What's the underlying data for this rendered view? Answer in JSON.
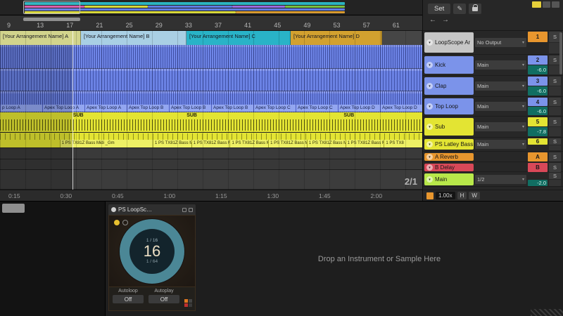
{
  "controls": {
    "set_label": "Set"
  },
  "icons": {
    "pencil": "✎",
    "arrow_left": "←",
    "arrow_right": "→",
    "chevron_down": "▾",
    "fold": "▾"
  },
  "transport": {
    "position": "2/1",
    "zoom": "1.00x",
    "h": "H",
    "w": "W"
  },
  "ruler": {
    "bars": [
      "9",
      "13",
      "17",
      "21",
      "25",
      "29",
      "33",
      "37",
      "41",
      "45",
      "49",
      "53",
      "57",
      "61"
    ],
    "times": [
      "0:15",
      "0:30",
      "0:45",
      "1:00",
      "1:15",
      "1:30",
      "1:45",
      "2:00"
    ]
  },
  "sections": [
    {
      "label": "[Your Arrangement Name] A",
      "color": "#d2d48c"
    },
    {
      "label": "[Your Arrangement Name] B",
      "color": "#a9cfe4"
    },
    {
      "label": "[Your Arrangement Name] C",
      "color": "#29b3c7"
    },
    {
      "label": "[Your Arrangement Name] D",
      "color": "#d2a12f"
    }
  ],
  "clips": {
    "top_loop": [
      "p Loop A",
      "Apex Top Loop A",
      "Apex Top Loop A",
      "Apex Top Loop B",
      "Apex Top Loop B",
      "Apex Top Loop B",
      "Apex Top Loop C",
      "Apex Top Loop C",
      "Apex Top Loop D",
      "Apex Top Loop D"
    ],
    "sub": [
      "SUB",
      "SUB",
      "SUB"
    ],
    "bass": [
      "1 PS TX81Z Bass Midi _Gm",
      "1 PS TX81Z Bass M",
      "1 PS TX81Z Bass M",
      "1 PS TX81Z Bass M",
      "1 PS TX81Z Bass M",
      "1 PS TX81Z Bass M",
      "1 PS TX81Z Bass M",
      "1 PS TX8"
    ]
  },
  "tracks": [
    {
      "name": "LoopScope Ar",
      "routing": "No Output",
      "num": "1",
      "num_color": "#e8962e",
      "name_bg": "#c6c6c6",
      "vol": "",
      "solo": "S"
    },
    {
      "name": "Kick",
      "routing": "Main",
      "num": "2",
      "num_color": "#7b93ea",
      "name_bg": "#7b93ea",
      "vol": "-6.0",
      "solo": "S"
    },
    {
      "name": "Clap",
      "routing": "Main",
      "num": "3",
      "num_color": "#7b93ea",
      "name_bg": "#7b93ea",
      "vol": "-6.0",
      "solo": "S"
    },
    {
      "name": "Top Loop",
      "routing": "Main",
      "num": "4",
      "num_color": "#7b93ea",
      "name_bg": "#7b93ea",
      "vol": "-6.0",
      "solo": "S"
    },
    {
      "name": "Sub",
      "routing": "Main",
      "num": "5",
      "num_color": "#e3e433",
      "name_bg": "#e3e433",
      "vol": "-7.8",
      "solo": "S"
    },
    {
      "name": "PS Latley Bass",
      "routing": "Main",
      "num": "6",
      "num_color": "#e3e433",
      "name_bg": "#e3e433",
      "vol": "",
      "solo": "S"
    },
    {
      "name": "A Reverb",
      "routing": "",
      "num": "A",
      "num_color": "#e8962e",
      "name_bg": "#e8962e",
      "vol": "",
      "solo": "S"
    },
    {
      "name": "B Delay",
      "routing": "",
      "num": "B",
      "num_color": "#d84858",
      "name_bg": "#d84858",
      "vol": "",
      "solo": "S"
    },
    {
      "name": "Main",
      "routing": "1/2",
      "num": "",
      "num_color": "",
      "name_bg": "#b8e84a",
      "vol": "-2.0",
      "solo": "S"
    }
  ],
  "device": {
    "title": "PS LoopSc…",
    "ratio_top": "1 / 16",
    "value": "16",
    "ratio_bottom": "1 / 64",
    "autoloop_label": "Autoloop",
    "autoloop_value": "Off",
    "autoplay_label": "Autoplay",
    "autoplay_value": "Off"
  },
  "drop_zone": "Drop an Instrument or Sample Here",
  "colors": {
    "clip_blue": "#6f86e8",
    "clip_yellow": "#e3e433",
    "return_orange": "#e8962e",
    "return_red": "#d84858",
    "main_lime": "#b8e84a",
    "section_teal": "#29b3c7",
    "dial_ring": "#4b8796"
  }
}
